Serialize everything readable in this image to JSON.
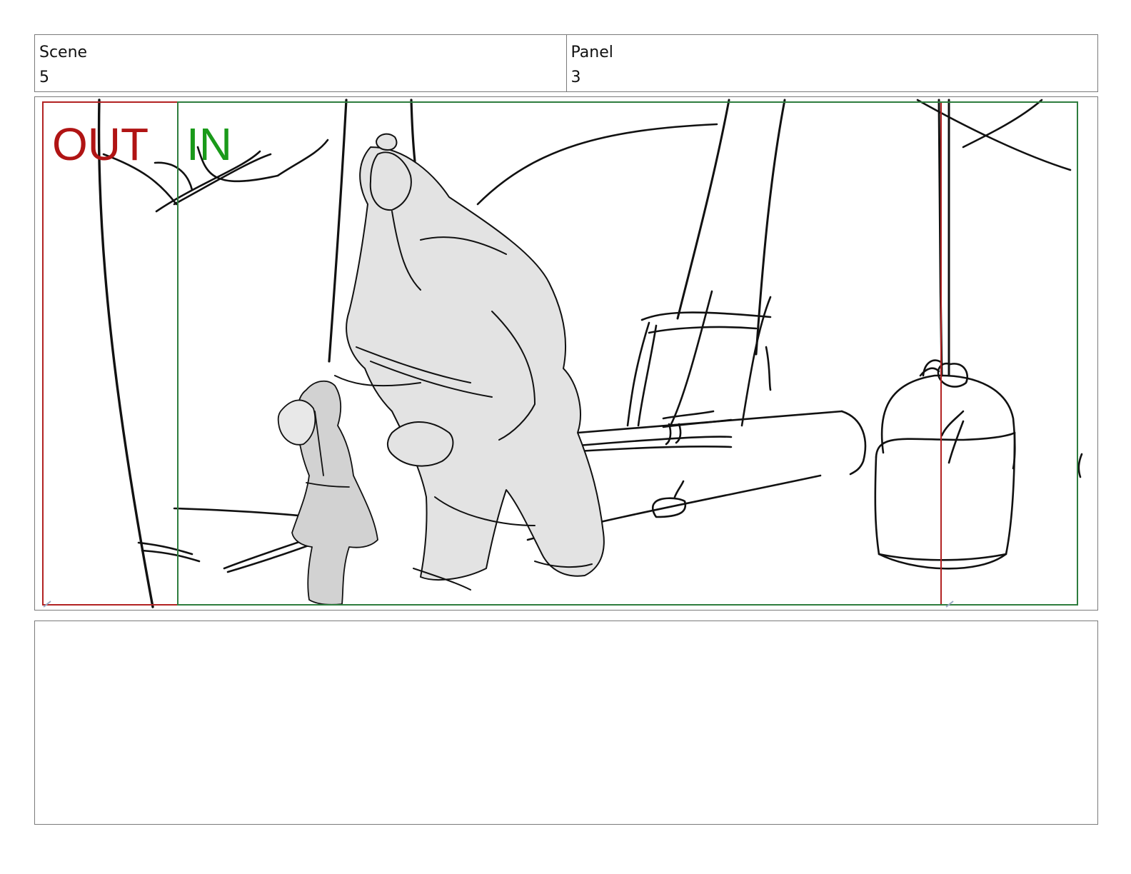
{
  "scene": {
    "label": "Scene",
    "value": "5"
  },
  "panel": {
    "label": "Panel",
    "value": "3"
  },
  "frame": {
    "out_label": "OUT",
    "in_label": "IN",
    "out_color": "#b01414",
    "in_color": "#1a9a1a",
    "out_frame_color": "#b22222",
    "in_frame_color": "#2e7d3e",
    "sketch_ink": "#111111",
    "character_fill": "#e3e3e3",
    "child_fill": "#d2d2d2"
  },
  "notes": {
    "text": ""
  }
}
